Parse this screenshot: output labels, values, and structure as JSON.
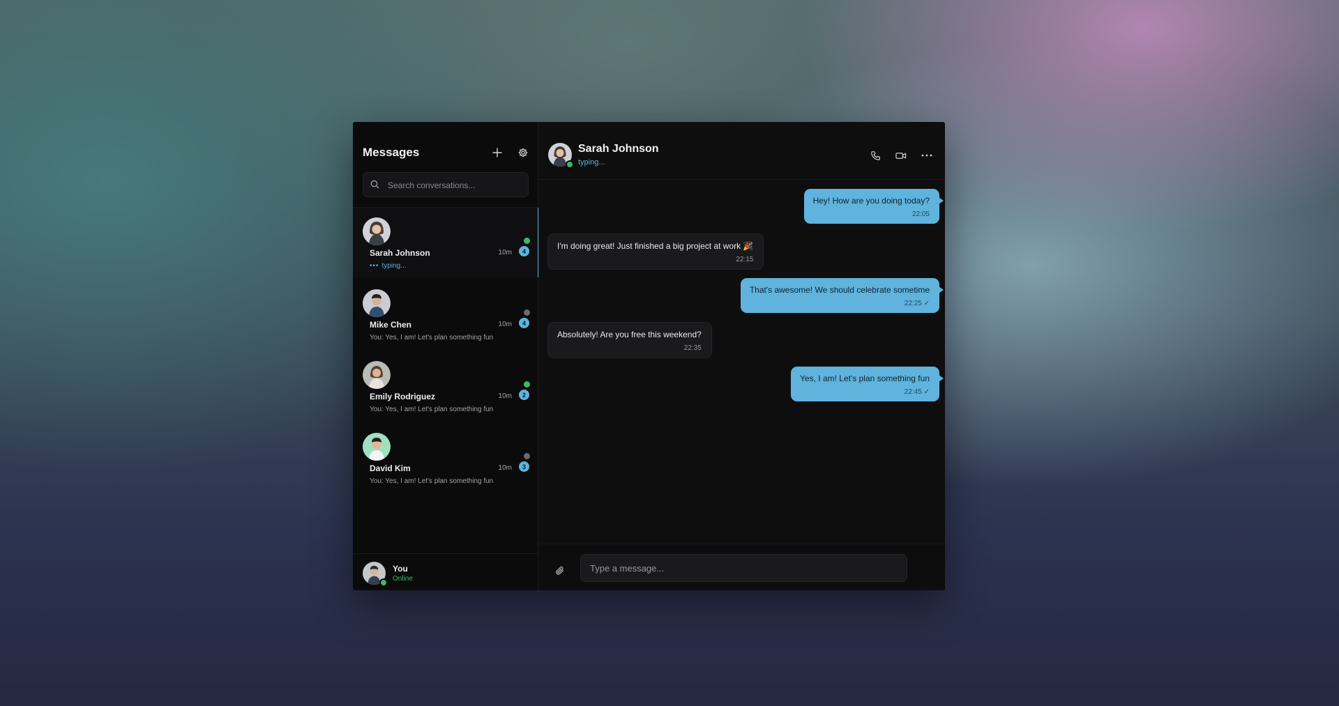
{
  "sidebar": {
    "title": "Messages",
    "search_placeholder": "Search conversations...",
    "conversations": [
      {
        "name": "Sarah Johnson",
        "time": "10m",
        "unread": "4",
        "online": true,
        "preview": "typing...",
        "typing": true
      },
      {
        "name": "Mike Chen",
        "time": "10m",
        "unread": "4",
        "online": false,
        "preview": "You: Yes, I am! Let's plan something fun",
        "typing": false
      },
      {
        "name": "Emily Rodriguez",
        "time": "10m",
        "unread": "2",
        "online": true,
        "preview": "You: Yes, I am! Let's plan something fun",
        "typing": false
      },
      {
        "name": "David Kim",
        "time": "10m",
        "unread": "3",
        "online": false,
        "preview": "You: Yes, I am! Let's plan something fun",
        "typing": false
      }
    ],
    "user": {
      "name": "You",
      "status": "Online"
    }
  },
  "chat": {
    "contact_name": "Sarah Johnson",
    "contact_status": "typing...",
    "messages": [
      {
        "direction": "out",
        "text": "Hey! How are you doing today?",
        "time": "22:05",
        "read": false
      },
      {
        "direction": "in",
        "text": "I'm doing great! Just finished a big project at work 🎉",
        "time": "22:15"
      },
      {
        "direction": "out",
        "text": "That's awesome! We should celebrate sometime",
        "time": "22:25",
        "read": true
      },
      {
        "direction": "in",
        "text": "Absolutely! Are you free this weekend?",
        "time": "22:35"
      },
      {
        "direction": "out",
        "text": "Yes, I am! Let's plan something fun",
        "time": "22:45",
        "read": true
      }
    ],
    "composer_placeholder": "Type a message..."
  },
  "colors": {
    "accent": "#5fb3dd",
    "online": "#3fb86b",
    "offline": "#6a6a70",
    "window_bg": "#0d0d0e"
  },
  "icons": {
    "new_chat": "plus-icon",
    "settings": "gear-icon",
    "search": "search-icon",
    "call": "phone-icon",
    "video": "video-icon",
    "more": "more-icon",
    "attach": "paperclip-icon",
    "read_receipt": "check-icon"
  }
}
